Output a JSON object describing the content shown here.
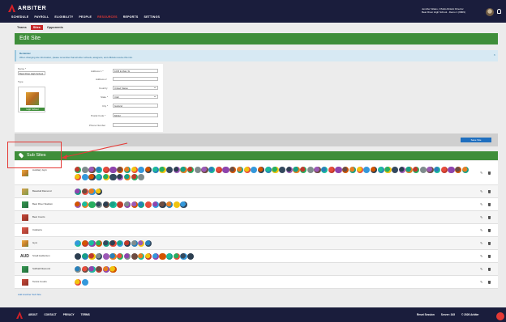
{
  "header": {
    "logo_text": "ARBITER",
    "nav": [
      "SCHEDULE",
      "PAYROLL",
      "ELIGIBILITY",
      "PEOPLE",
      "RESOURCES",
      "REPORTS",
      "SETTINGS"
    ],
    "active_nav_index": 4,
    "user_line1": "Jennifer Wales, OSHA Athletic Director",
    "user_line2": "Bear River High School - Demo 1 (9809)"
  },
  "subtabs": {
    "items": [
      "Teams",
      "Sites",
      "Opponents"
    ],
    "active_index": 1
  },
  "page_title": "Edit Site",
  "reminder": {
    "title": "Reminder",
    "body": "When changing site information, please remember that all other schools, assignors, and officials receive this info."
  },
  "form": {
    "name_label": "Name *",
    "name_value": "Bear River High School",
    "type_label": "Type",
    "type_value": "High School",
    "address1_label": "Address 1 *",
    "address1_value": "1005 E Main St",
    "address2_label": "Address 2",
    "address2_value": "",
    "country_label": "Country",
    "country_value": "United States",
    "state_label": "State *",
    "state_value": "Utah",
    "city_label": "City *",
    "city_value": "Garland",
    "postal_label": "Postal Code *",
    "postal_value": "84312",
    "phone_label": "Phone Number",
    "phone_value": ""
  },
  "save_button": "Save Site",
  "subsites": {
    "title": "Sub Sites",
    "rows": [
      {
        "name": "Auxiliary Gym",
        "icon": "gym-icon",
        "circles": 66
      },
      {
        "name": "Baseball Diamond",
        "icon": "baseball-field-icon",
        "circles": 4
      },
      {
        "name": "Bear River Stadium",
        "icon": "stadium-icon",
        "circles": 16
      },
      {
        "name": "Bear Courts",
        "icon": "tennis-court-icon",
        "circles": 0
      },
      {
        "name": "Cafeteria",
        "icon": "cafeteria-icon",
        "circles": 0
      },
      {
        "name": "Gym",
        "icon": "gym-icon",
        "circles": 11
      },
      {
        "name": "Small Auditorium",
        "icon": "auditorium-icon",
        "label": "AUD",
        "circles": 17
      },
      {
        "name": "Softball Diamond",
        "icon": "softball-field-icon",
        "circles": 6
      },
      {
        "name": "Tennis Courts",
        "icon": "tennis-court-icon",
        "circles": 2
      }
    ],
    "add_link": "Add Another Sub Site"
  },
  "footer": {
    "links": [
      "ABOUT",
      "CONTACT",
      "PRIVACY",
      "TERMS"
    ],
    "reset": "Reset Session",
    "server": "Server: 345",
    "copyright": "© 2026 Arbiter"
  },
  "colors": {
    "nav_bg": "#1a1d3c",
    "accent_red": "#d62027",
    "header_green": "#3f8e3a",
    "link_blue": "#1f6fbf"
  }
}
